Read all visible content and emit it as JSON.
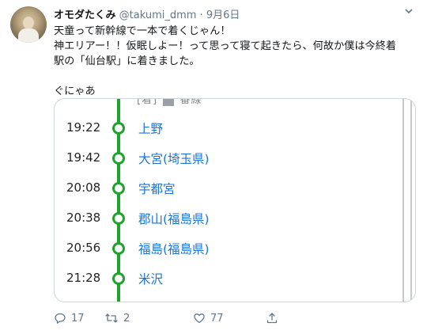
{
  "user": {
    "name": "オモダたくみ",
    "handle": "@takumi_dmm",
    "dot": "·",
    "date": "9月6日"
  },
  "tweet": {
    "lines": [
      "天童って新幹線で一本で着くじゃん！",
      "神エリアー！！仮眠しよー！って思って寝て起きたら、何故か僕は今終着",
      "駅の「仙台駅」に着きました。"
    ],
    "last_line": "ぐにゃあ"
  },
  "card": {
    "top_partial": "[着]",
    "top_partial_tail": "番線",
    "stops": [
      {
        "time": "19:22",
        "station": "上野"
      },
      {
        "time": "19:42",
        "station": "大宮(埼玉県)"
      },
      {
        "time": "20:08",
        "station": "宇都宮"
      },
      {
        "time": "20:38",
        "station": "郡山(福島県)"
      },
      {
        "time": "20:56",
        "station": "福島(福島県)"
      },
      {
        "time": "21:28",
        "station": "米沢"
      }
    ],
    "colors": {
      "route": "#1fa32c",
      "station_link": "#1b74d8"
    }
  },
  "actions": {
    "replies": "17",
    "retweets": "2",
    "likes": "77"
  },
  "icons": [
    "avatar",
    "chevron-down-icon",
    "reply-icon",
    "retweet-icon",
    "like-icon",
    "share-icon"
  ]
}
